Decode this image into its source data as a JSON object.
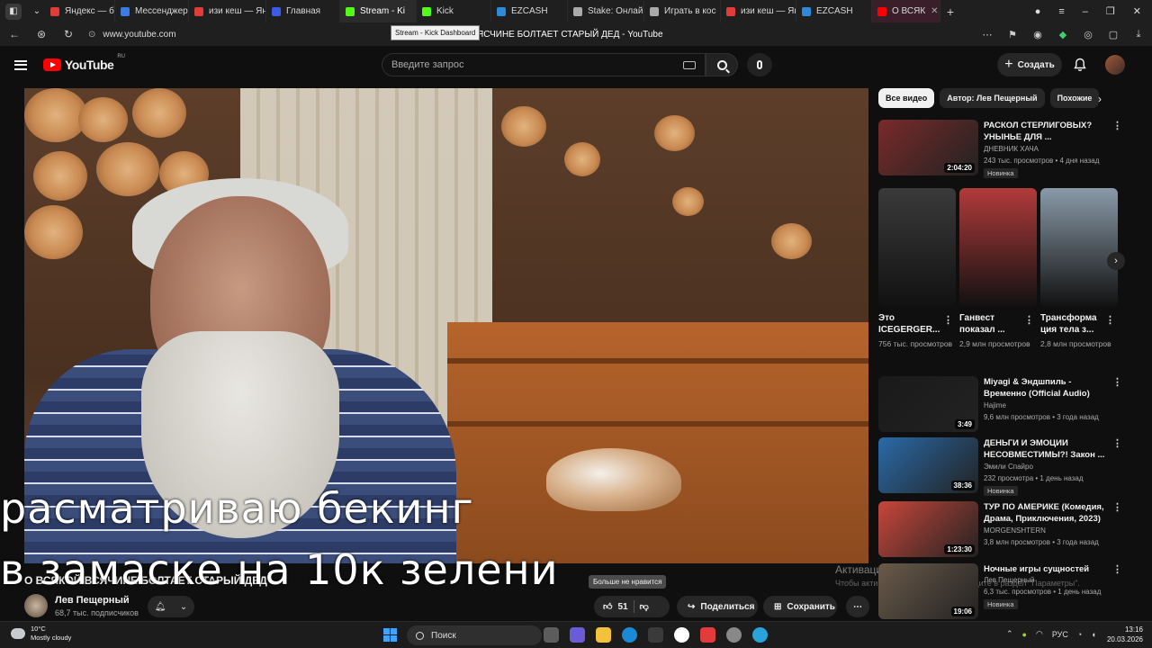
{
  "browser": {
    "tabs": [
      {
        "label": "Яндекс — бы",
        "color": "#e23b3b"
      },
      {
        "label": "Мессенджер",
        "color": "#3b7be2"
      },
      {
        "label": "изи кеш — Ян",
        "color": "#e23b3b"
      },
      {
        "label": "Главная",
        "color": "#3b5be2"
      },
      {
        "label": "Stream - Ki",
        "color": "#53fc18"
      },
      {
        "label": "Kick",
        "color": "#53fc18"
      },
      {
        "label": "EZCASH",
        "color": "#2e8ad8"
      },
      {
        "label": "Stake: Онлай",
        "color": "#aaaaaa"
      },
      {
        "label": "Играть в кос",
        "color": "#aaaaaa"
      },
      {
        "label": "изи кеш — Ян",
        "color": "#e23b3b"
      },
      {
        "label": "EZCASH",
        "color": "#2e8ad8"
      },
      {
        "label": "О ВСЯК",
        "color": "#ff0000"
      }
    ],
    "tooltip": "Stream - Kick Dashboard",
    "url": "www.youtube.com",
    "page_title": "ЯСЧИНЕ БОЛТАЕТ СТАРЫЙ ДЕД - YouTube"
  },
  "youtube": {
    "logo_text": "YouTube",
    "logo_region": "RU",
    "search_placeholder": "Введите запрос",
    "create_label": "Создать"
  },
  "video": {
    "overlay_line1": "расматриваю бекинг",
    "overlay_line2": "в замаске  на 10к зелени",
    "title": "О ВСЯКОЙ ВСЯЧИНЕ БОЛТАЕТ СТАРЫЙ ДЕД",
    "watermark_line1": "Активация Windows",
    "watermark_line2": "Чтобы активировать Windows, перейдите в раздел \"Параметры\".",
    "channel_name": "Лев Пещерный",
    "channel_subs": "68,7 тыс. подписчиков",
    "likes": "51",
    "dislike_hint": "Больше не нравится",
    "share_label": "Поделиться",
    "save_label": "Сохранить"
  },
  "sidebar": {
    "chips": [
      "Все видео",
      "Автор: Лев Пещерный",
      "Похожие"
    ],
    "recs": [
      {
        "title": "РАСКОЛ СТЕРЛИГОВЫХ? УНЫНЬЕ ДЛЯ ...",
        "channel": "ДНЕВНИК ХАЧА",
        "meta": "243 тыс. просмотров • 4 дня назад",
        "badge": "Новинка",
        "duration": "2:04:20",
        "color": "#7a2a2a"
      },
      {
        "title": "Miyagi & Эндшпиль - Временно (Official Audio)",
        "channel": "Hajime",
        "meta": "9,6 млн просмотров • 3 года назад",
        "badge": "",
        "duration": "3:49",
        "color": "#1a1a1a"
      },
      {
        "title": "ДЕНЬГИ И ЭМОЦИИ НЕСОВМЕСТИМЫ?! Закон ...",
        "channel": "Эмили Спайро",
        "meta": "232 просмотра • 1 день назад",
        "badge": "Новинка",
        "duration": "38:36",
        "color": "#2a6aa8"
      },
      {
        "title": "ТУР ПО АМЕРИКЕ (Комедия, Драма, Приключения, 2023)",
        "channel": "MORGENSHTERN",
        "meta": "3,8 млн просмотров • 3 года назад",
        "badge": "",
        "duration": "1:23:30",
        "color": "#c8463a"
      },
      {
        "title": "Ночные игры сущностей",
        "channel": "Лев Пещерный",
        "meta": "6,3 тыс. просмотров • 1 день назад",
        "badge": "Новинка",
        "duration": "19:06",
        "color": "#6a5a4a"
      }
    ],
    "shorts": [
      {
        "title": "Это ICEGERGER...",
        "views": "756 тыс. просмотров",
        "color": "#3a3a3a"
      },
      {
        "title": "Ганвест показал ...",
        "views": "2,9 млн просмотров",
        "color": "#b23a3a"
      },
      {
        "title": "Трансформа ция тела з...",
        "views": "2,8 млн просмотров",
        "color": "#8a9aa8"
      }
    ]
  },
  "taskbar": {
    "temp": "10°C",
    "weather": "Mostly cloudy",
    "search": "Поиск",
    "lang": "РУС",
    "time": "13:16",
    "date": "20.03.2026"
  }
}
